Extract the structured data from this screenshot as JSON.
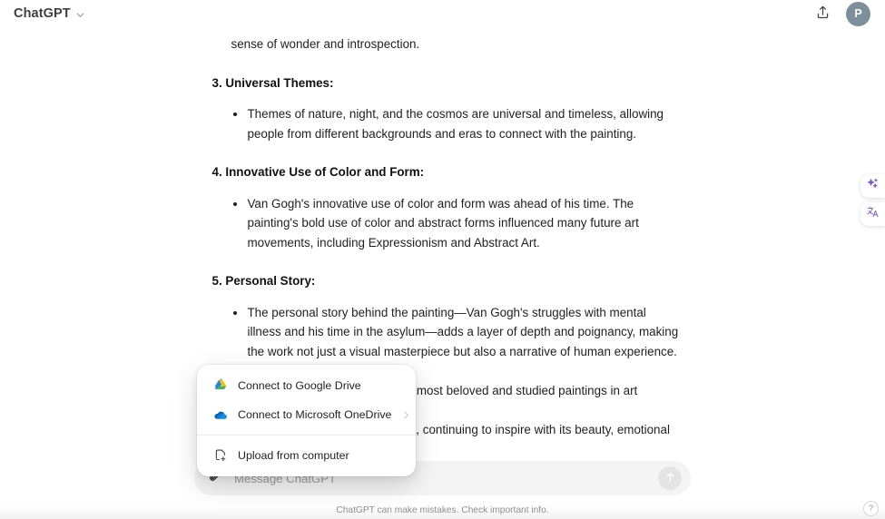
{
  "header": {
    "brand_title": "ChatGPT",
    "chevron_icon": "chevron-down-icon",
    "share_icon": "share-upload-icon",
    "avatar_initial": "P",
    "avatar_color": "#7d8f9b"
  },
  "conversation": {
    "continued_line": "sense of wonder and introspection.",
    "sections": [
      {
        "heading": "3. Universal Themes:",
        "bullets": [
          "Themes of nature, night, and the cosmos are universal and timeless, allowing people from different backgrounds and eras to connect with the painting."
        ]
      },
      {
        "heading": "4. Innovative Use of Color and Form:",
        "bullets": [
          "Van Gogh's innovative use of color and form was ahead of his time. The painting's bold use of color and abstract forms influenced many future art movements, including Expressionism and Abstract Art."
        ]
      },
      {
        "heading": "5. Personal Story:",
        "bullets": [
          "The personal story behind the painting—Van Gogh's struggles with mental illness and his time in the asylum—adds a layer of depth and poignancy, making the work not just a visual masterpiece but also a narrative of human experience."
        ]
      }
    ],
    "closing_line_1": "\"The Starry Night\" remains one of the most beloved and studied paintings in art history, capturing",
    "closing_line_2": "the imagination of all who encounter it, continuing to inspire with its beauty, emotional intensity, and innovative"
  },
  "attach_menu": {
    "items": [
      {
        "label": "Connect to Google Drive",
        "icon": "google-drive-icon",
        "has_chevron": false
      },
      {
        "label": "Connect to Microsoft OneDrive",
        "icon": "onedrive-cloud-icon",
        "has_chevron": true,
        "chevron_icon": "chevron-right-icon"
      },
      {
        "label": "Upload from computer",
        "icon": "upload-file-icon",
        "has_chevron": false
      }
    ]
  },
  "composer": {
    "attach_icon": "paperclip-icon",
    "placeholder": "Message ChatGPT",
    "value": "",
    "send_icon": "arrow-up-icon",
    "send_button_color": "#e4e4e4"
  },
  "footer": {
    "disclaimer": "ChatGPT can make mistakes. Check important info."
  },
  "side_widgets": {
    "accent_color": "#7c58c8",
    "items": [
      {
        "icon": "sparkle-ai-icon"
      },
      {
        "icon": "translate-icon"
      }
    ]
  },
  "help": {
    "label": "?"
  }
}
